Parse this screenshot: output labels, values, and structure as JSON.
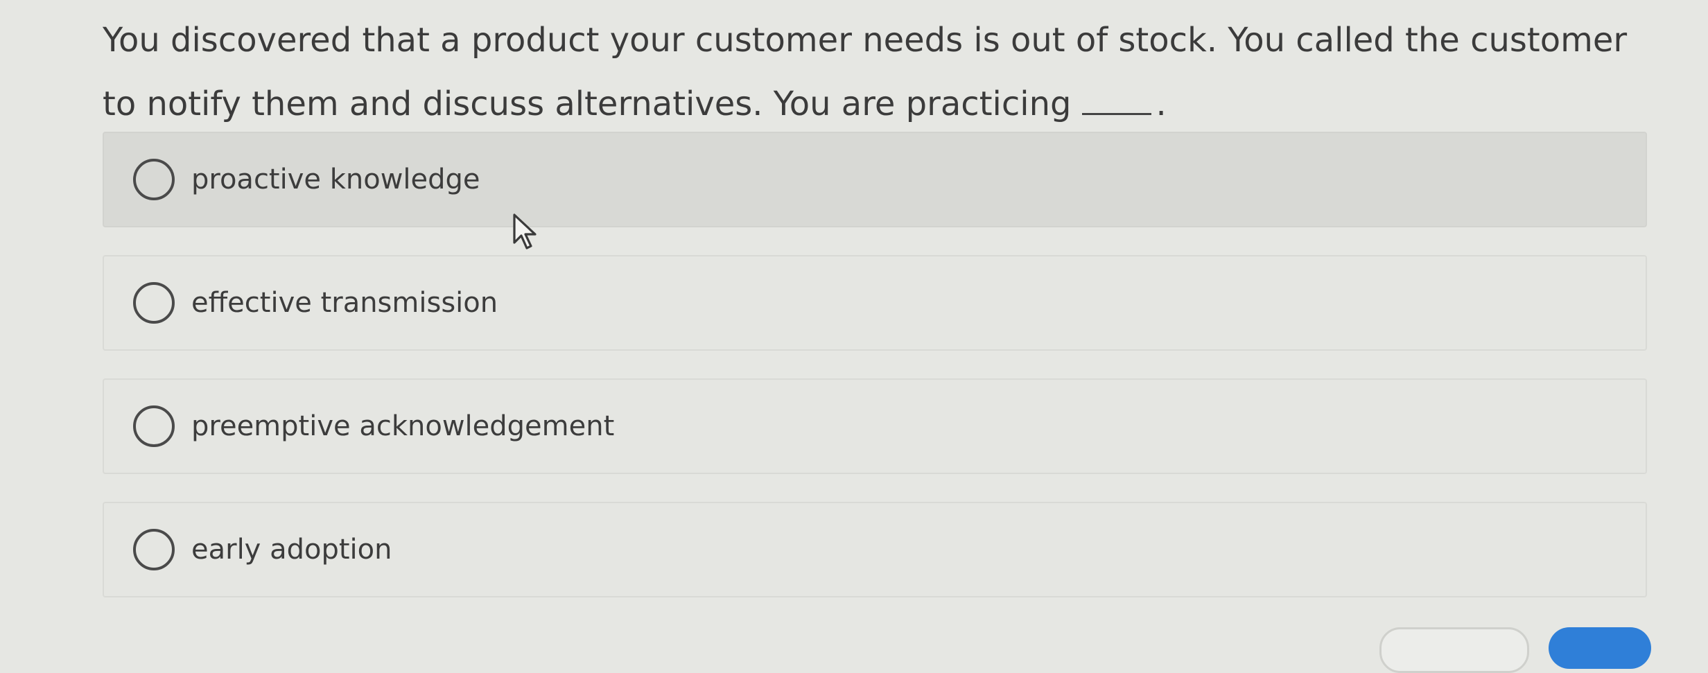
{
  "question": {
    "text": "You discovered that a product your customer needs is out of stock. You called the customer to notify them and discuss alternatives. You are practicing",
    "end_punctuation": "."
  },
  "options": [
    {
      "label": "proactive knowledge",
      "selected": false
    },
    {
      "label": "effective transmission",
      "selected": false
    },
    {
      "label": "preemptive acknowledgement",
      "selected": false
    },
    {
      "label": "early adoption",
      "selected": false
    }
  ],
  "colors": {
    "background": "#e6e7e3",
    "hover_background": "#d8d9d5",
    "primary_button": "#2f7fd8"
  }
}
